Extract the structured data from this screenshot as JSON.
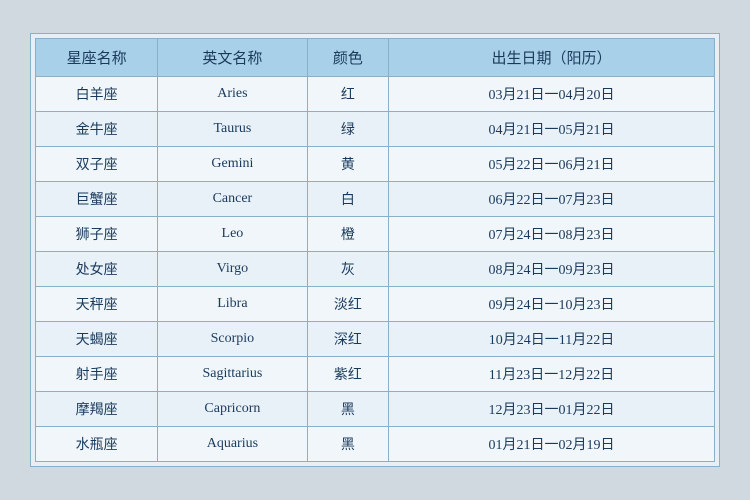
{
  "table": {
    "headers": [
      "星座名称",
      "英文名称",
      "颜色",
      "出生日期（阳历）"
    ],
    "rows": [
      {
        "zh": "白羊座",
        "en": "Aries",
        "color": "红",
        "date": "03月21日一04月20日"
      },
      {
        "zh": "金牛座",
        "en": "Taurus",
        "color": "绿",
        "date": "04月21日一05月21日"
      },
      {
        "zh": "双子座",
        "en": "Gemini",
        "color": "黄",
        "date": "05月22日一06月21日"
      },
      {
        "zh": "巨蟹座",
        "en": "Cancer",
        "color": "白",
        "date": "06月22日一07月23日"
      },
      {
        "zh": "狮子座",
        "en": "Leo",
        "color": "橙",
        "date": "07月24日一08月23日"
      },
      {
        "zh": "处女座",
        "en": "Virgo",
        "color": "灰",
        "date": "08月24日一09月23日"
      },
      {
        "zh": "天秤座",
        "en": "Libra",
        "color": "淡红",
        "date": "09月24日一10月23日"
      },
      {
        "zh": "天蝎座",
        "en": "Scorpio",
        "color": "深红",
        "date": "10月24日一11月22日"
      },
      {
        "zh": "射手座",
        "en": "Sagittarius",
        "color": "紫红",
        "date": "11月23日一12月22日"
      },
      {
        "zh": "摩羯座",
        "en": "Capricorn",
        "color": "黑",
        "date": "12月23日一01月22日"
      },
      {
        "zh": "水瓶座",
        "en": "Aquarius",
        "color": "黑",
        "date": "01月21日一02月19日"
      }
    ]
  }
}
